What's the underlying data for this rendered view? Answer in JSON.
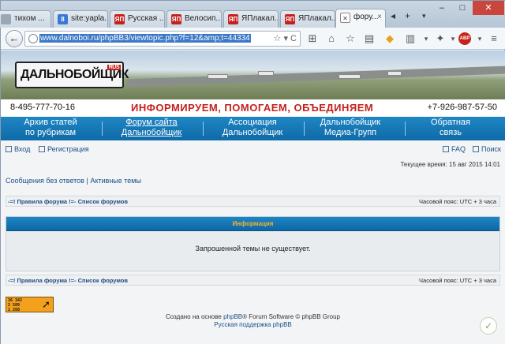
{
  "browser": {
    "tabs": [
      {
        "label": "тихом ...",
        "icon": "generic-page-icon",
        "icon_text": ""
      },
      {
        "label": "site:yapla...",
        "icon": "google-icon",
        "icon_text": "8"
      },
      {
        "label": "Русская ...",
        "icon": "yaplakal-icon",
        "icon_text": "ЯП"
      },
      {
        "label": "Велосип...",
        "icon": "yaplakal-icon",
        "icon_text": "ЯП"
      },
      {
        "label": "ЯПлакал...",
        "icon": "yaplakal-icon",
        "icon_text": "ЯП"
      },
      {
        "label": "ЯПлакал...",
        "icon": "yaplakal-icon",
        "icon_text": "ЯП"
      },
      {
        "label": "фору...",
        "icon": "forum-icon",
        "icon_text": "",
        "active": true
      }
    ],
    "new_tab": "+",
    "url": "www.dalnoboi.ru/phpBB3/viewtopic.php?f=12&amp;t=44334",
    "abp_label": "ABP"
  },
  "site": {
    "logo_text": "ДАЛЬНОБОЙЩИК",
    "logo_badge": "RUS",
    "phone_left": "8-495-777-70-16",
    "slogan": "ИНФОРМИРУЕМ, ПОМОГАЕМ, ОБЪЕДИНЯЕМ",
    "phone_right": "+7-926-987-57-50",
    "menu": [
      {
        "line1": "Архив статей",
        "line2": "по рубрикам"
      },
      {
        "line1": "Форум сайта",
        "line2": "Дальнобойщик"
      },
      {
        "line1": "Ассоциация",
        "line2": "Дальнобойщик"
      },
      {
        "line1": "Дальнобойщик",
        "line2": "Медиа-Групп"
      },
      {
        "line1": "Обратная",
        "line2": "связь"
      }
    ]
  },
  "forum": {
    "login": "Вход",
    "register": "Регистрация",
    "faq": "FAQ",
    "search": "Поиск",
    "current_time": "Текущее время: 15 авг 2015 14:01",
    "unanswered": "Сообщения без ответов",
    "link_sep": "|",
    "active_topics": "Активные темы",
    "breadcrumb": "-=! Правила форума !=- Список форумов",
    "timezone": "Часовой пояс: UTC + 3 часа",
    "info_title": "Информация",
    "info_message": "Запрошенной темы не существует.",
    "counter_lines": [
      "36 342",
      "2 589",
      "1 260"
    ],
    "footer_prefix": "Создано на основе",
    "footer_phpbb": "phpBB",
    "footer_suffix": "® Forum Software © phpBB Group",
    "footer_support": "Русская поддержка phpBB"
  }
}
